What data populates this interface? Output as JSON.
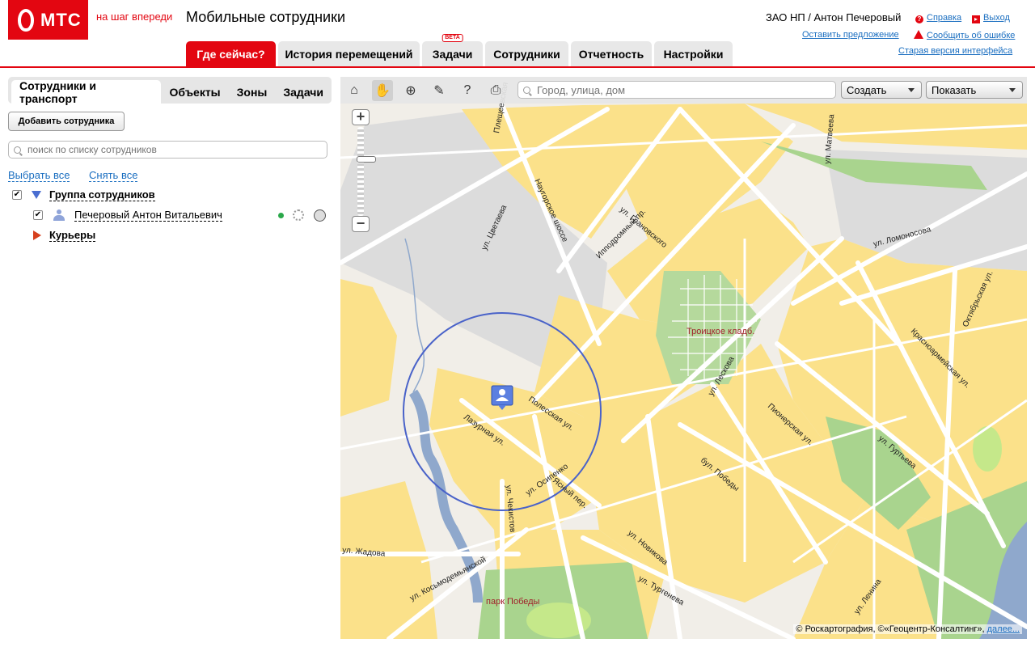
{
  "header": {
    "logo_text": "МТС",
    "slogan": "на шаг впереди",
    "app_title": "Мобильные сотрудники",
    "user": "ЗАО НП / Антон Печеровый",
    "help": "Справка",
    "logout": "Выход",
    "suggest": "Оставить предложение",
    "report_error": "Сообщить об ошибке",
    "old_interface": "Старая версия интерфейса",
    "colors": {
      "brand_red": "#e30611",
      "link_blue": "#1a6ec0"
    }
  },
  "nav_tabs": [
    {
      "label": "Где сейчас?",
      "active": true
    },
    {
      "label": "История перемещений",
      "active": false
    },
    {
      "label": "Задачи",
      "active": false,
      "badge": "BETA"
    },
    {
      "label": "Сотрудники",
      "active": false
    },
    {
      "label": "Отчетность",
      "active": false
    },
    {
      "label": "Настройки",
      "active": false
    }
  ],
  "panel": {
    "tabs": [
      {
        "label": "Сотрудники и транспорт",
        "active": true
      },
      {
        "label": "Объекты",
        "active": false
      },
      {
        "label": "Зоны",
        "active": false
      },
      {
        "label": "Задачи",
        "active": false
      }
    ],
    "add_button": "Добавить сотрудника",
    "search_placeholder": "поиск по списку сотрудников",
    "select_all": "Выбрать все",
    "deselect_all": "Снять все",
    "tree": {
      "group1": {
        "label": "Группа сотрудников",
        "checked": true,
        "expanded": true
      },
      "employee": {
        "label": "Печеровый Антон Витальевич",
        "checked": true,
        "status": "online"
      },
      "group2": {
        "label": "Курьеры",
        "expanded": false
      }
    }
  },
  "map": {
    "toolbar_icons": [
      "home-icon",
      "hand-icon",
      "zoom-area-icon",
      "ruler-icon",
      "info-cursor-icon",
      "print-icon"
    ],
    "search_placeholder": "Город, улица, дом",
    "create_label": "Создать",
    "show_label": "Показать",
    "zoom_in": "+",
    "zoom_out": "−",
    "copyright": "© Роскартография, ©«Геоцентр-Консалтинг»,",
    "more_link": "далее...",
    "place_labels": {
      "cemetery": "Троицкое кладб.",
      "park": "парк Победы"
    },
    "street_labels": [
      "Полесская ул.",
      "Лазурная ул.",
      "Ясный пер.",
      "ул. Осипенко",
      "ул. Чекистов",
      "ул. Лескова",
      "бул. Победы",
      "Пионерская ул.",
      "ул. Новикова",
      "ул. Тургенева",
      "ул. Цветаева",
      "Наугорское шоссе",
      "Ипподромный пр.",
      "ул. Грановского",
      "ул. Ломоносова",
      "Октябрьская ул.",
      "Красноармейская ул.",
      "ул. Гуртьева",
      "ул. Матвеева",
      "Плещеевская",
      "ул. Косьмодемьянской",
      "ул. Жадова",
      "ул. Ленина"
    ],
    "colors": {
      "block": "#fbe18a",
      "road": "#ffffff",
      "green": "#a9d48e",
      "water": "#8fa8cc",
      "circle": "#4a63c9"
    }
  }
}
